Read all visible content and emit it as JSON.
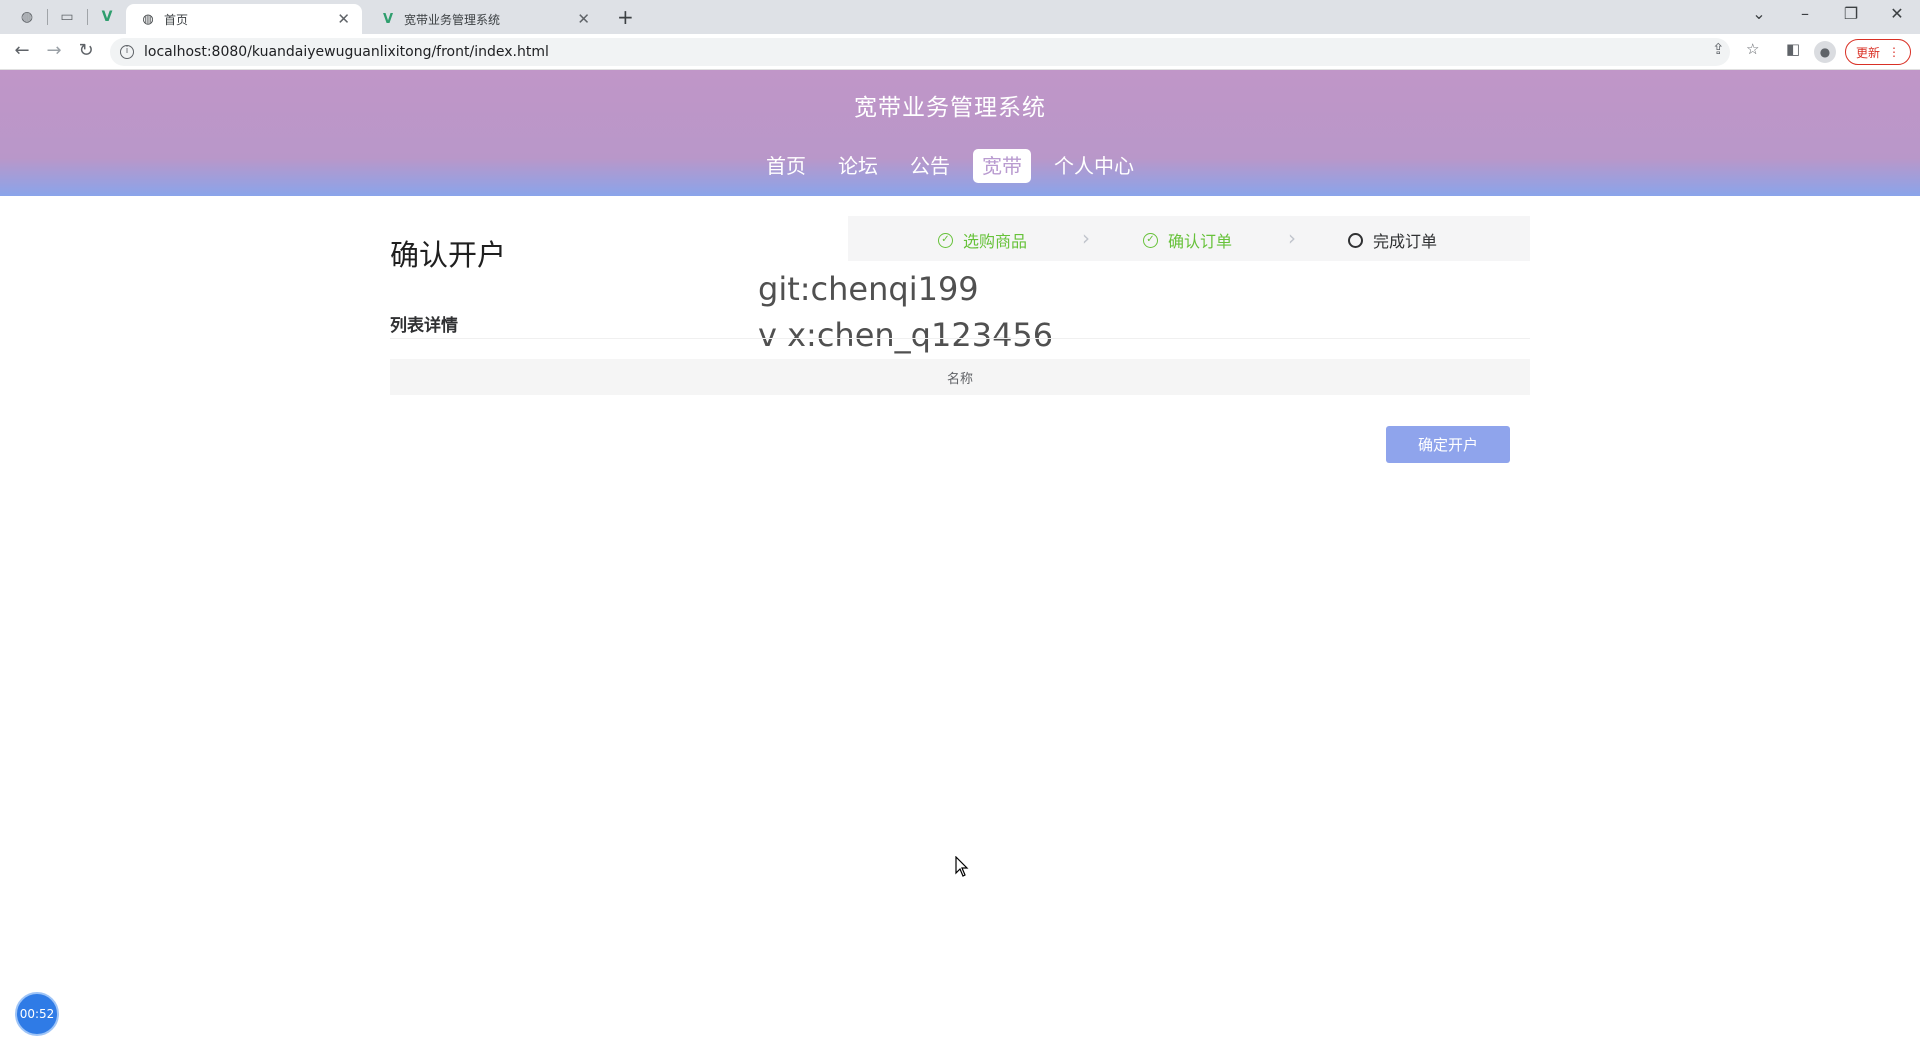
{
  "browser": {
    "tabs": [
      {
        "title": "首页",
        "active": true
      },
      {
        "title": "宽带业务管理系统",
        "active": false
      }
    ],
    "url": "localhost:8080/kuandaiyewuguanlixitong/front/index.html",
    "update_label": "更新"
  },
  "header": {
    "title": "宽带业务管理系统",
    "nav": [
      {
        "label": "首页",
        "active": false
      },
      {
        "label": "论坛",
        "active": false
      },
      {
        "label": "公告",
        "active": false
      },
      {
        "label": "宽带",
        "active": true
      },
      {
        "label": "个人中心",
        "active": false
      }
    ]
  },
  "main": {
    "heading": "确认开户",
    "steps": [
      {
        "label": "选购商品",
        "status": "done"
      },
      {
        "label": "确认订单",
        "status": "done"
      },
      {
        "label": "完成订单",
        "status": "current"
      }
    ],
    "watermark": [
      "git:chenqi199",
      "v x:chen_q123456"
    ],
    "section_label": "列表详情",
    "table": {
      "columns": [
        "名称"
      ],
      "rows": []
    },
    "confirm_button": "确定开户"
  },
  "overlay": {
    "timer": "00:52"
  },
  "colors": {
    "header_top": "#c096c8",
    "header_bottom": "#8aa4ea",
    "success": "#67c23a",
    "primary_button": "#8fa4ec"
  }
}
